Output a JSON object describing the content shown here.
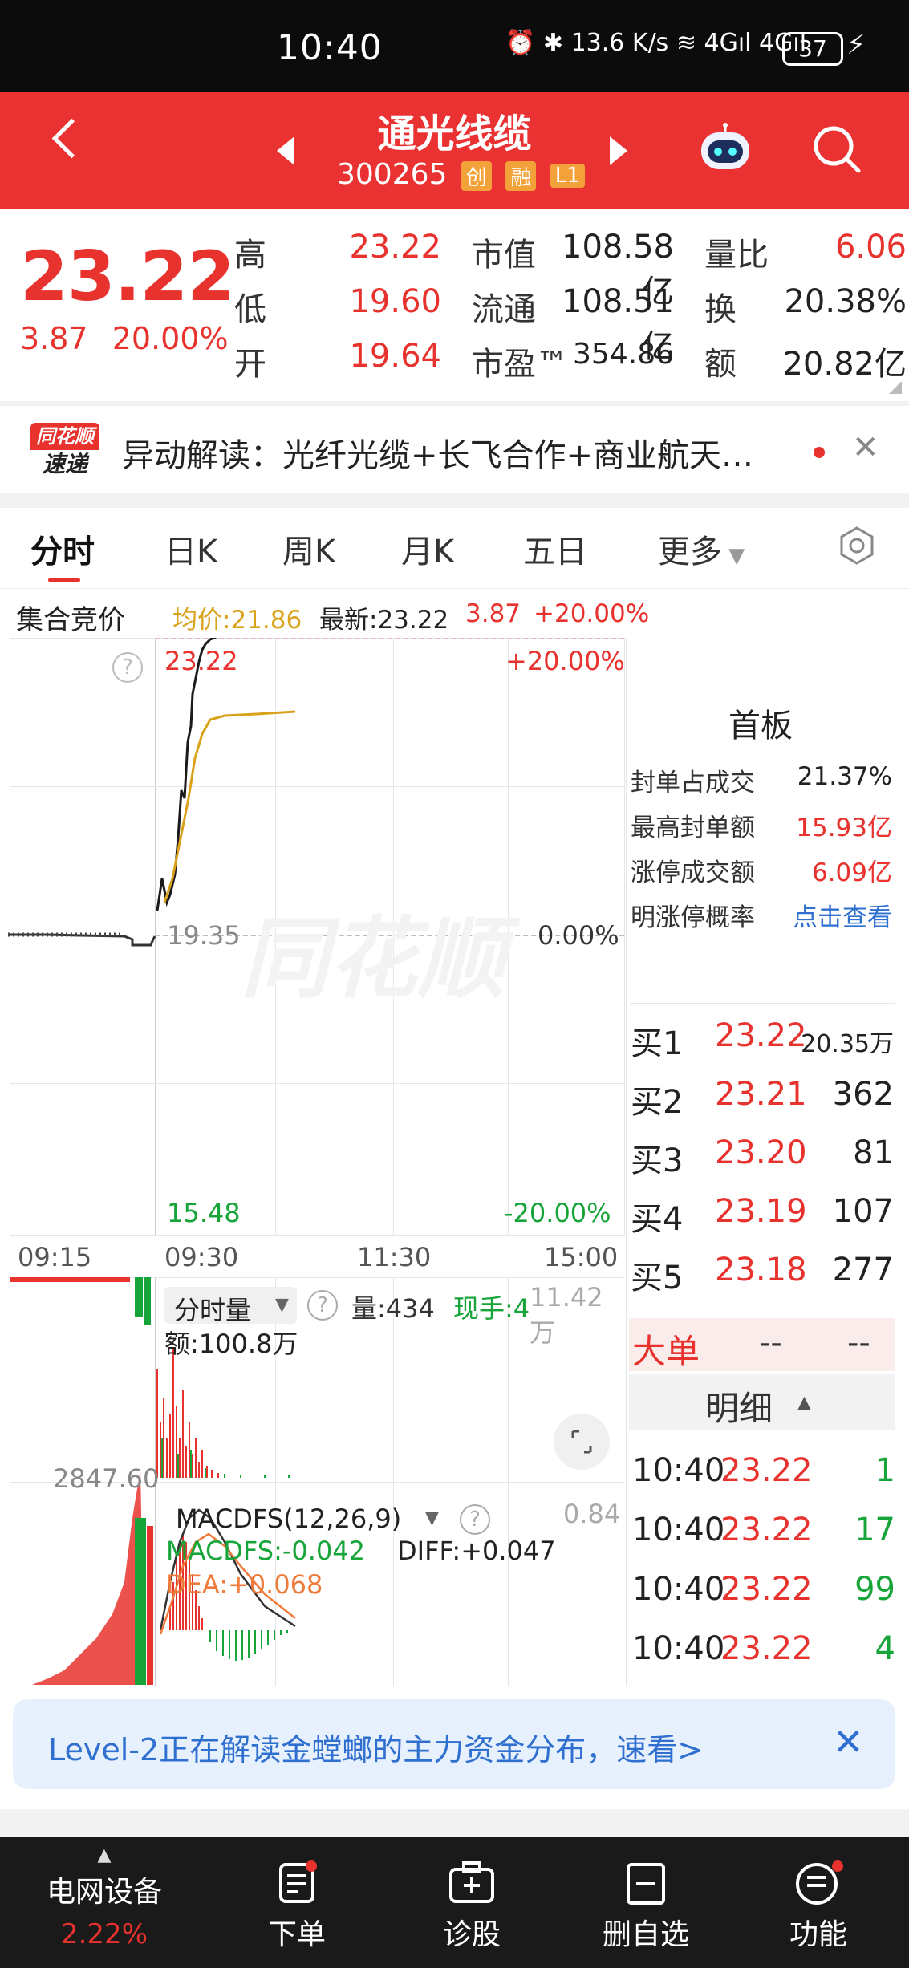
{
  "status_bar": {
    "time": "10:40",
    "indicators": "⏰ ✱ 13.6 K/s ≋ 4Gıl 4Gıl",
    "battery": "37"
  },
  "header": {
    "stock_name": "通光线缆",
    "code": "300265",
    "tags": [
      "创",
      "融",
      "L1"
    ]
  },
  "quote": {
    "price": "23.22",
    "change": "3.87",
    "change_pct": "20.00%",
    "rows": [
      {
        "l1": "高",
        "v1": "23.22",
        "l2": "市值",
        "v2": "108.58亿",
        "l3": "量比",
        "v3": "6.06"
      },
      {
        "l1": "低",
        "v1": "19.60",
        "l2": "流通",
        "v2": "108.51亿",
        "l3": "换",
        "v3": "20.38%"
      },
      {
        "l1": "开",
        "v1": "19.64",
        "l2": "市盈™",
        "v2": "354.86",
        "l3": "额",
        "v3": "20.82亿"
      }
    ]
  },
  "alert": {
    "logo_top": "同花顺",
    "logo_bottom": "速递",
    "text": "异动解读：光纤光缆+长飞合作+商业航天…"
  },
  "tabs": [
    "分时",
    "日K",
    "周K",
    "月K",
    "五日",
    "更多"
  ],
  "chart_header": {
    "auction_label": "集合竞价",
    "avg_label": "均价:21.86",
    "latest_label": "最新:23.22",
    "change": "3.87",
    "change_pct": "+20.00%"
  },
  "chart": {
    "top_price": "23.22",
    "top_pct": "+20.00%",
    "mid_price": "19.35",
    "mid_pct": "0.00%",
    "bottom_price": "15.48",
    "bottom_pct": "-20.00%",
    "time_labels": [
      "09:15",
      "09:30",
      "11:30",
      "15:00"
    ],
    "watermark": "同花顺",
    "volume_selector": "分时量",
    "volume_label": "量:434",
    "hand_label": "现手:4",
    "volume_max": "11.42万",
    "amount_label": "额:100.8万",
    "auction_vol": "2847.60",
    "macd_selector": "MACDFS(12,26,9)",
    "macd_value": "MACDFS:-0.042",
    "diff_value": "DIFF:+0.047",
    "dea_value": "DEA:+0.068",
    "macd_max": "0.84"
  },
  "limit_panel": {
    "title": "首板",
    "rows": [
      {
        "label": "封单占成交",
        "value": "21.37%"
      },
      {
        "label": "最高封单额",
        "value": "15.93亿"
      },
      {
        "label": "涨停成交额",
        "value": "6.09亿"
      },
      {
        "label": "明涨停概率",
        "value": "点击查看"
      }
    ]
  },
  "order_book": [
    {
      "label": "买1",
      "price": "23.22",
      "vol": "20.35万"
    },
    {
      "label": "买2",
      "price": "23.21",
      "vol": "362"
    },
    {
      "label": "买3",
      "price": "23.20",
      "vol": "81"
    },
    {
      "label": "买4",
      "price": "23.19",
      "vol": "107"
    },
    {
      "label": "买5",
      "price": "23.18",
      "vol": "277"
    }
  ],
  "big_order": {
    "label": "大单",
    "v1": "--",
    "v2": "--"
  },
  "detail": {
    "title": "明细",
    "rows": [
      {
        "time": "10:40",
        "price": "23.22",
        "vol": "1"
      },
      {
        "time": "10:40",
        "price": "23.22",
        "vol": "17"
      },
      {
        "time": "10:40",
        "price": "23.22",
        "vol": "99"
      },
      {
        "time": "10:40",
        "price": "23.22",
        "vol": "4"
      }
    ]
  },
  "banner": {
    "text": "Level-2正在解读金螳螂的主力资金分布，速看>"
  },
  "bottom_nav": {
    "sector": "电网设备",
    "sector_pct": "2.22%",
    "items": [
      "下单",
      "诊股",
      "删自选",
      "功能"
    ]
  },
  "colors": {
    "up": "#e8322e",
    "down": "#17a53a",
    "header": "#ea3232",
    "price_line": "#222222",
    "avg_line": "#d9a21b",
    "link": "#2f6fd0"
  }
}
